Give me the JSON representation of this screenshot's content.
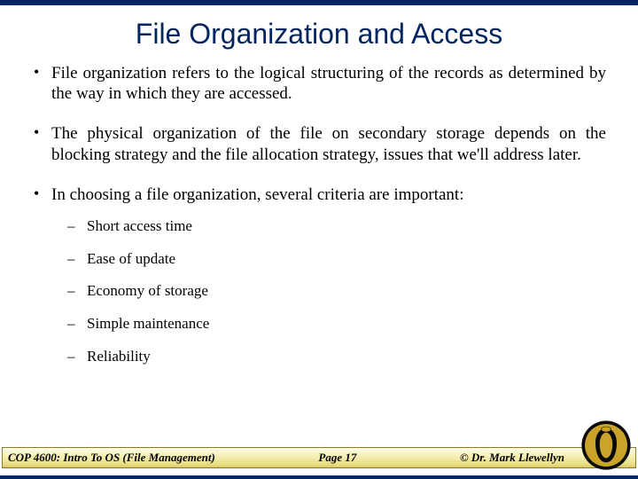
{
  "title": "File Organization and Access",
  "bullets": [
    {
      "text": "File organization refers to the logical structuring of the records as determined by the way in which they are accessed."
    },
    {
      "text": "The physical organization of the file on secondary storage depends on the blocking strategy and the file allocation strategy, issues that we'll address later."
    },
    {
      "text": "In choosing a file organization, several criteria are important:",
      "sub": [
        "Short access time",
        "Ease of update",
        "Economy of storage",
        "Simple maintenance",
        "Reliability"
      ]
    }
  ],
  "footer": {
    "course": "COP 4600: Intro To OS  (File Management)",
    "page": "Page  17",
    "copyright": "© Dr. Mark Llewellyn"
  }
}
